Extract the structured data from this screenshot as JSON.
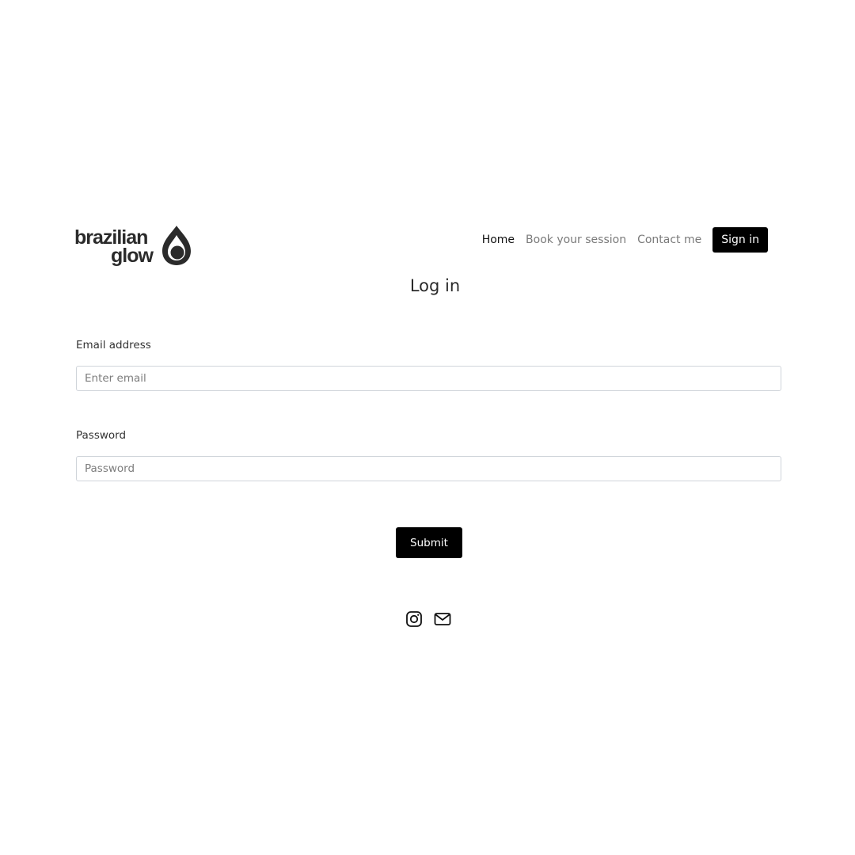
{
  "brand": {
    "logo_line1": "brazilian",
    "logo_line2": "glow",
    "logo_color": "#2b2b2b"
  },
  "nav": {
    "items": [
      {
        "label": "Home",
        "active": true
      },
      {
        "label": "Book your session",
        "active": false
      },
      {
        "label": "Contact me",
        "active": false
      }
    ],
    "signin_label": "Sign in"
  },
  "page": {
    "title": "Log in"
  },
  "form": {
    "email": {
      "label": "Email address",
      "placeholder": "Enter email",
      "value": ""
    },
    "password": {
      "label": "Password",
      "placeholder": "Password",
      "value": ""
    },
    "submit_label": "Submit"
  },
  "footer": {
    "icons": [
      "instagram-icon",
      "mail-icon"
    ]
  },
  "colors": {
    "primary_button": "#000000",
    "nav_inactive": "#7a7a7a",
    "nav_active": "#111111",
    "input_border": "#cfd4da"
  }
}
